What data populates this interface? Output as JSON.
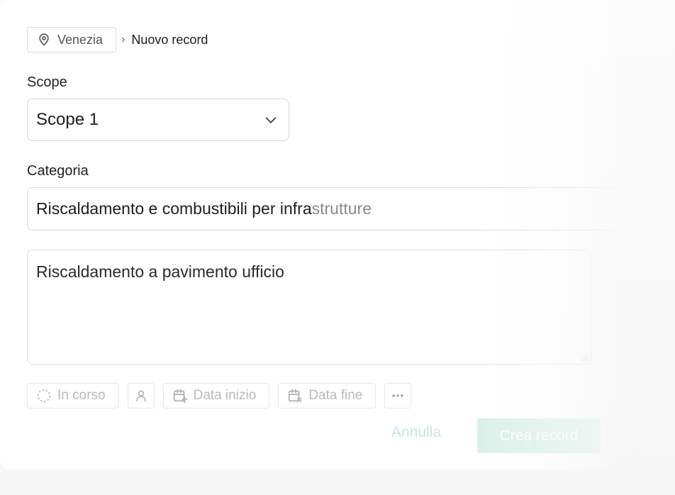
{
  "breadcrumb": {
    "location": "Venezia",
    "location_icon": "map-pin-icon",
    "separator": "›",
    "current": "Nuovo record"
  },
  "scope": {
    "label": "Scope",
    "value": "Scope 1"
  },
  "category": {
    "label": "Categoria",
    "value_main": "Riscaldamento e combustibili per infra",
    "value_faded": "strutture"
  },
  "description": {
    "value": "Riscaldamento a pavimento ufficio"
  },
  "chips": {
    "status": "In corso",
    "status_icon": "dashed-circle-icon",
    "assignee_icon": "user-icon",
    "start_date": "Data inizio",
    "start_icon": "calendar-arrow-icon",
    "end_date": "Data fine",
    "end_icon": "calendar-x-icon",
    "more_icon": "more-horizontal-icon"
  },
  "footer": {
    "cancel": "Annulla",
    "create": "Crea record"
  },
  "colors": {
    "accent": "#d9f0e8",
    "cancel_text": "#c7e6dd",
    "chip_text": "#b9b9b9"
  }
}
